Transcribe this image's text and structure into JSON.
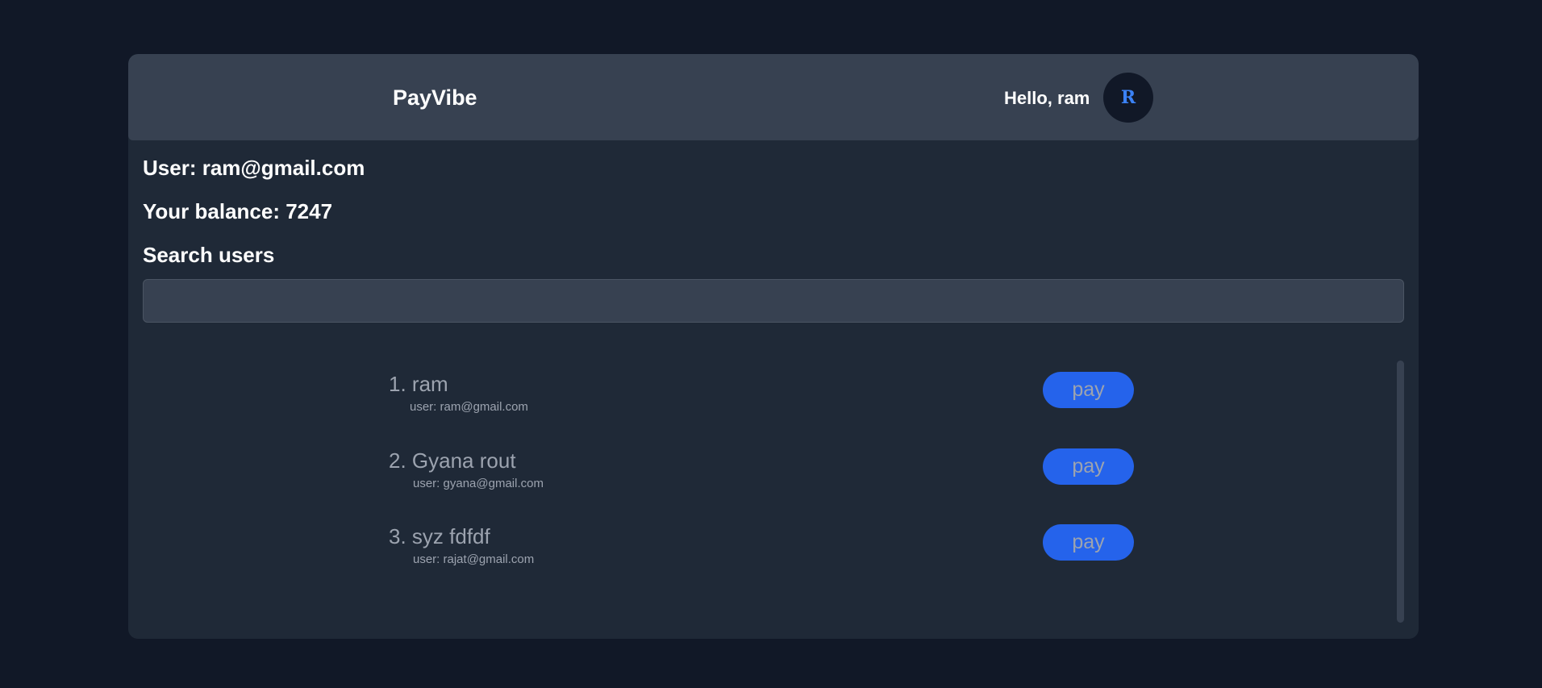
{
  "header": {
    "brand": "PayVibe",
    "greeting": "Hello, ram",
    "avatar_initial": "R"
  },
  "account": {
    "user_line": "User: ram@gmail.com",
    "balance_line": "Your balance: 7247"
  },
  "search": {
    "label": "Search users",
    "value": "",
    "placeholder": ""
  },
  "users": [
    {
      "index_name": "1. ram",
      "email_line": "user: ram@gmail.com",
      "action_label": "pay"
    },
    {
      "index_name": "2. Gyana rout",
      "email_line": "user: gyana@gmail.com",
      "action_label": "pay"
    },
    {
      "index_name": "3. syz fdfdf",
      "email_line": "user: rajat@gmail.com",
      "action_label": "pay"
    }
  ],
  "colors": {
    "page_background": "#111827",
    "card_background": "#1f2937",
    "header_background": "#374151",
    "accent": "#2563eb",
    "muted_text": "#9ca3af"
  }
}
